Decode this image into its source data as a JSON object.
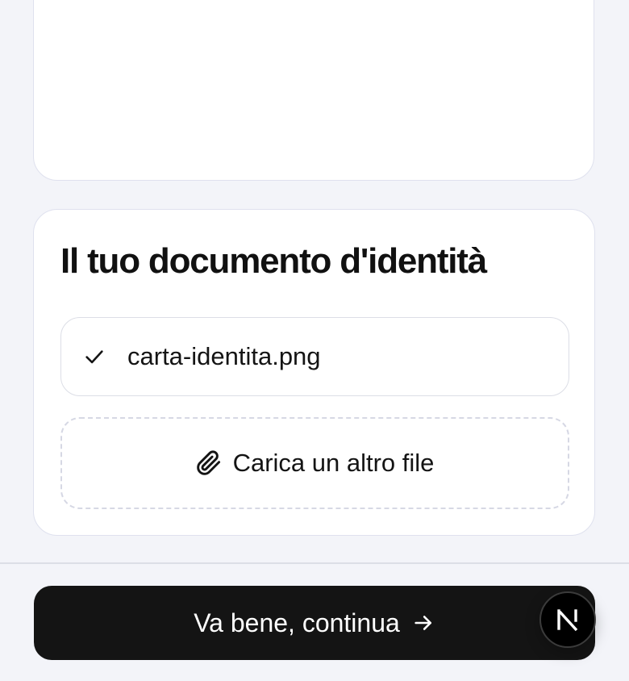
{
  "document_section": {
    "title": "Il tuo documento d'identità",
    "files": [
      {
        "name": "carta-identita.png",
        "status_icon": "check-icon"
      }
    ],
    "upload_label": "Carica un altro file",
    "upload_icon": "paperclip-icon"
  },
  "footer": {
    "continue_label": "Va bene, continua",
    "continue_icon": "arrow-right-icon"
  },
  "dev_badge": {
    "letter": "N",
    "icon": "nextjs-logo-icon"
  },
  "colors": {
    "background": "#f3f4f9",
    "card": "#ffffff",
    "border": "#dfe1ee",
    "primary_button": "#141414",
    "primary_text": "#ffffff"
  }
}
